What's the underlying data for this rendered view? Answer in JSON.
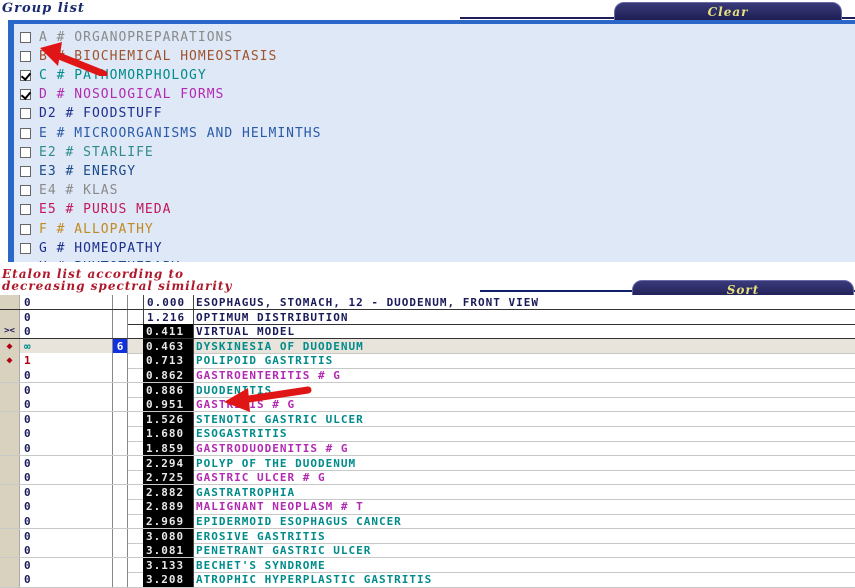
{
  "group_list": {
    "title": "Group list",
    "clear_label": "Clear",
    "items": [
      {
        "label": "A # ORGANOPREPARATIONS",
        "checked": false,
        "color": "#8a8a8a"
      },
      {
        "label": "B # BIOCHEMICAL  HOMEOSTASIS",
        "checked": false,
        "color": "#a0522d"
      },
      {
        "label": "C # PATHOMORPHOLOGY",
        "checked": true,
        "color": "#008b8b"
      },
      {
        "label": "D # NOSOLOGICAL  FORMS",
        "checked": true,
        "color": "#b22ab2"
      },
      {
        "label": "D2 # FOODSTUFF",
        "checked": false,
        "color": "#1c2f8c"
      },
      {
        "label": "E # MICROORGANISMS  AND  HELMINTHS",
        "checked": false,
        "color": "#2a5aa8"
      },
      {
        "label": "E2 # STARLIFE",
        "checked": false,
        "color": "#2e8b8b"
      },
      {
        "label": "E3 # ENERGY",
        "checked": false,
        "color": "#1a4a8a"
      },
      {
        "label": "E4 # KLAS",
        "checked": false,
        "color": "#8a8a8a"
      },
      {
        "label": "E5 # PURUS MEDA",
        "checked": false,
        "color": "#c2185b"
      },
      {
        "label": "F # ALLOPATHY",
        "checked": false,
        "color": "#c08a20"
      },
      {
        "label": "G # HOMEOPATHY",
        "checked": false,
        "color": "#1c2f8c"
      },
      {
        "label": "H # PHYTOTHERAPY",
        "checked": false,
        "color": "#1a4a8a"
      }
    ]
  },
  "etalon": {
    "title_line1": "Etalon list according to",
    "title_line2": "decreasing spectral similarity",
    "sort_label": "Sort",
    "rows": [
      {
        "marker": "",
        "count": "0",
        "flag": "",
        "value": "0.000",
        "name": "ESOPHAGUS, STOMACH, 12 - DUODENUM, FRONT VIEW",
        "color": "#1a1a5a"
      },
      {
        "marker": "",
        "count": "0",
        "flag": "",
        "value": "1.216",
        "name": "OPTIMUM DISTRIBUTION",
        "color": "#1a1a5a"
      },
      {
        "marker": "><",
        "count": "0",
        "flag": "",
        "value": "0.411",
        "name": "VIRTUAL MODEL",
        "color": "#1a1a5a"
      },
      {
        "marker": "◆",
        "count": "∞",
        "flag": "6",
        "value": "0.463",
        "name": "DYSKINESIA  OF DUODENUM",
        "color": "#008b8b"
      },
      {
        "marker": "◆",
        "count": "1",
        "flag": "",
        "value": "0.713",
        "name": "POLIPOID  GASTRITIS",
        "color": "#008b8b"
      },
      {
        "marker": "",
        "count": "0",
        "flag": "",
        "value": "0.862",
        "name": "GASTROENTERITIS # G",
        "color": "#b22ab2"
      },
      {
        "marker": "",
        "count": "0",
        "flag": "",
        "value": "0.886",
        "name": "DUODENITIS",
        "color": "#008b8b"
      },
      {
        "marker": "",
        "count": "0",
        "flag": "",
        "value": "0.951",
        "name": "GASTRITIS  # G",
        "color": "#b22ab2"
      },
      {
        "marker": "",
        "count": "0",
        "flag": "",
        "value": "1.526",
        "name": "STENOTIC  GASTRIC  ULCER",
        "color": "#008b8b"
      },
      {
        "marker": "",
        "count": "0",
        "flag": "",
        "value": "1.680",
        "name": "ESOGASTRITIS",
        "color": "#008b8b"
      },
      {
        "marker": "",
        "count": "0",
        "flag": "",
        "value": "1.859",
        "name": "GASTRODUODENITIS # G",
        "color": "#b22ab2"
      },
      {
        "marker": "",
        "count": "0",
        "flag": "",
        "value": "2.294",
        "name": "POLYP  OF  THE  DUODENUM",
        "color": "#008b8b"
      },
      {
        "marker": "",
        "count": "0",
        "flag": "",
        "value": "2.725",
        "name": "GASTRIC ULCER # G",
        "color": "#b22ab2"
      },
      {
        "marker": "",
        "count": "0",
        "flag": "",
        "value": "2.882",
        "name": "GASTRATROPHIA",
        "color": "#008b8b"
      },
      {
        "marker": "",
        "count": "0",
        "flag": "",
        "value": "2.889",
        "name": "MALIGNANT  NEOPLASM  # T",
        "color": "#b22ab2"
      },
      {
        "marker": "",
        "count": "0",
        "flag": "",
        "value": "2.969",
        "name": "EPIDERMOID  ESOPHAGUS  CANCER",
        "color": "#008b8b"
      },
      {
        "marker": "",
        "count": "0",
        "flag": "",
        "value": "3.080",
        "name": "EROSIVE GASTRITIS",
        "color": "#008b8b"
      },
      {
        "marker": "",
        "count": "0",
        "flag": "",
        "value": "3.081",
        "name": "PENETRANT  GASTRIC  ULCER",
        "color": "#008b8b"
      },
      {
        "marker": "",
        "count": "0",
        "flag": "",
        "value": "3.133",
        "name": "BECHET'S  SYNDROME",
        "color": "#008b8b"
      },
      {
        "marker": "",
        "count": "0",
        "flag": "",
        "value": "3.208",
        "name": "ATROPHIC  HYPERPLASTIC GASTRITIS",
        "color": "#008b8b"
      }
    ]
  }
}
